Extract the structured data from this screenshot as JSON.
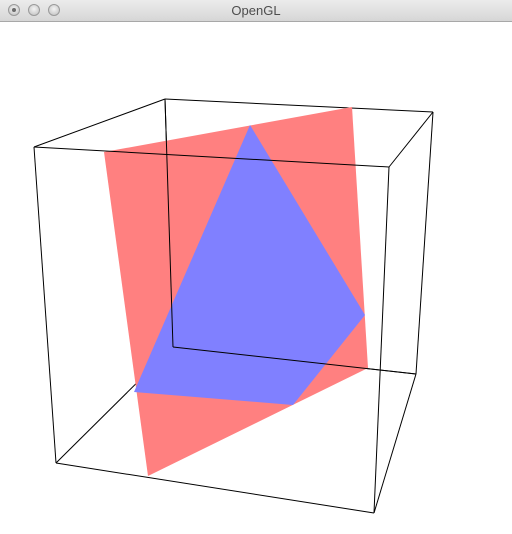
{
  "window": {
    "title": "OpenGL"
  },
  "scene": {
    "background_color": "#ffffff",
    "edge_color": "#000000",
    "red_plane_color": "#ff8080",
    "blue_triangle_color": "#8080ff"
  }
}
